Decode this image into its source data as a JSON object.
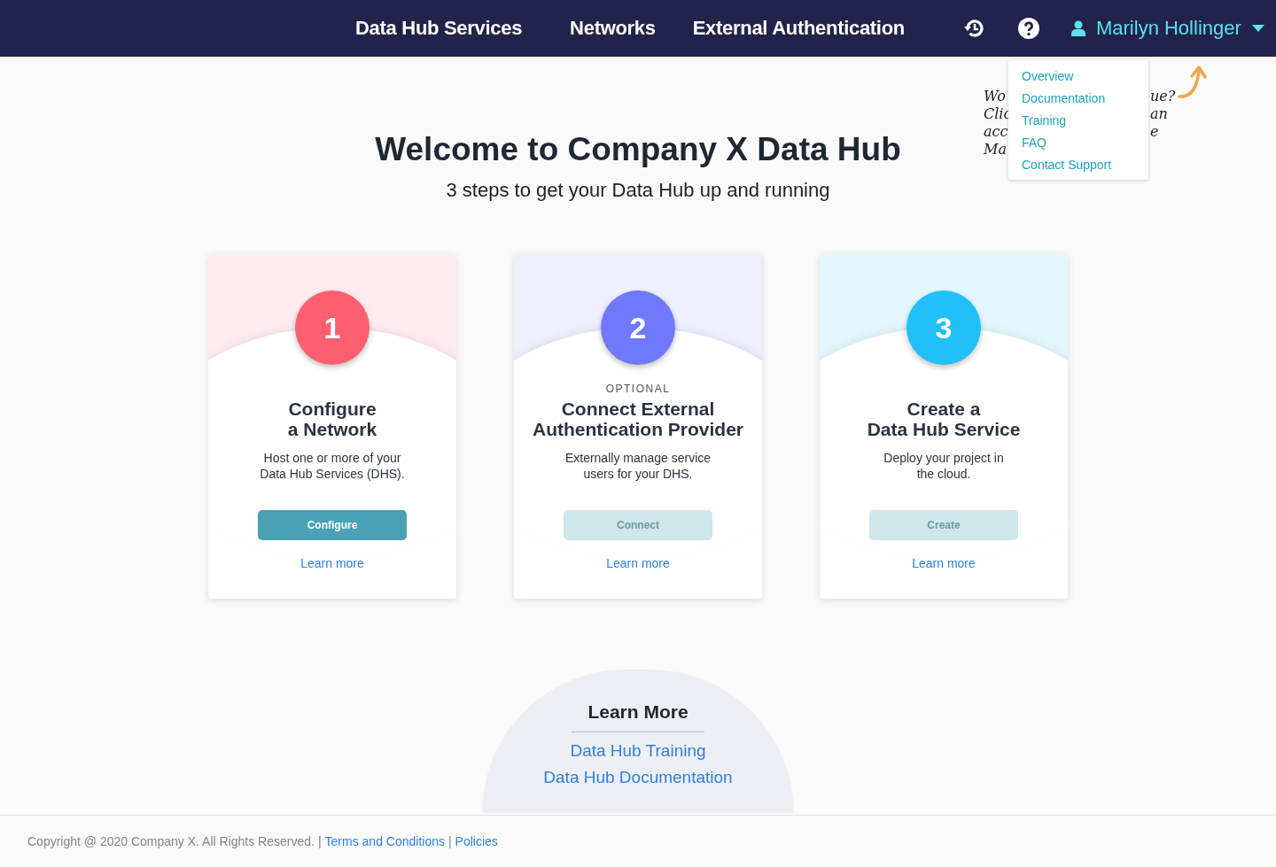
{
  "nav": {
    "links": [
      "Data Hub Services",
      "Networks",
      "External Authentication"
    ],
    "user": "Marilyn Hollinger"
  },
  "help_menu": {
    "items": [
      "Overview",
      "Documentation",
      "Training",
      "FAQ",
      "Contact Support"
    ]
  },
  "note": {
    "left": [
      "Wo",
      "Clic",
      "acc",
      "Ma"
    ],
    "right": [
      "ue?",
      "an",
      "e"
    ]
  },
  "hero": {
    "title": "Welcome to Company X Data Hub",
    "subtitle": "3 steps to get your Data Hub up and running"
  },
  "steps": [
    {
      "number": "1",
      "color": "#fe5f70",
      "title": [
        "Configure",
        "a Network"
      ],
      "text": [
        "Host one or more of your",
        "Data Hub Services (DHS)."
      ],
      "button": "Configure",
      "disabled": false,
      "link": "Learn more"
    },
    {
      "number": "2",
      "color": "#7078fb",
      "tag": "OPTIONAL",
      "title": [
        "Connect External",
        "Authentication Provider"
      ],
      "text": [
        "Externally manage service",
        "users for your DHS."
      ],
      "button": "Connect",
      "disabled": true,
      "link": "Learn more"
    },
    {
      "number": "3",
      "color": "#21c0fb",
      "title": [
        "Create a",
        "Data Hub Service"
      ],
      "text": [
        "Deploy your project in",
        "the cloud."
      ],
      "button": "Create",
      "disabled": true,
      "link": "Learn more"
    }
  ],
  "learn_more": {
    "title": "Learn More",
    "links": [
      "Data Hub Training",
      "Data Hub Documentation"
    ]
  },
  "footer": {
    "copyright": "Copyright @ 2020 Company X. All Rights Reserved.",
    "links": [
      {
        "separator": "|",
        "label": "Terms and Conditions"
      },
      {
        "separator": "|",
        "label": "Policies"
      }
    ]
  }
}
